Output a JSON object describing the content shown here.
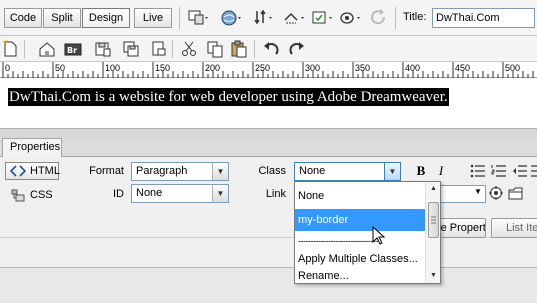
{
  "toolbar": {
    "views": [
      "Code",
      "Split",
      "Design",
      "Live"
    ],
    "active_view": "Design",
    "title_label": "Title:",
    "title_value": "DwThai.Com"
  },
  "ruler": {
    "ticks": [
      "0",
      "50",
      "100",
      "150",
      "200",
      "250",
      "300",
      "350",
      "400",
      "450",
      "500"
    ]
  },
  "document": {
    "text": "DwThai.Com is a website for web developer using Adobe Dreamweaver."
  },
  "properties": {
    "tab_label": "Properties",
    "html_label": "HTML",
    "css_label": "CSS",
    "format_label": "Format",
    "format_value": "Paragraph",
    "id_label": "ID",
    "id_value": "None",
    "class_label": "Class",
    "class_value": "None",
    "link_label": "Link",
    "bold": "B",
    "italic": "I",
    "page_properties_btn": "Page Properties...",
    "list_item_btn": "List Item..."
  },
  "class_dropdown": {
    "items": [
      {
        "label": "None"
      },
      {
        "label": "my-border",
        "selected": true
      },
      {
        "label": "---------------------------------"
      },
      {
        "label": "Apply Multiple Classes..."
      },
      {
        "label": "Rename..."
      }
    ]
  },
  "colors": {
    "accent": "#3399ff",
    "selection_bg": "#000000",
    "panel_bg": "#f0f0f0"
  }
}
